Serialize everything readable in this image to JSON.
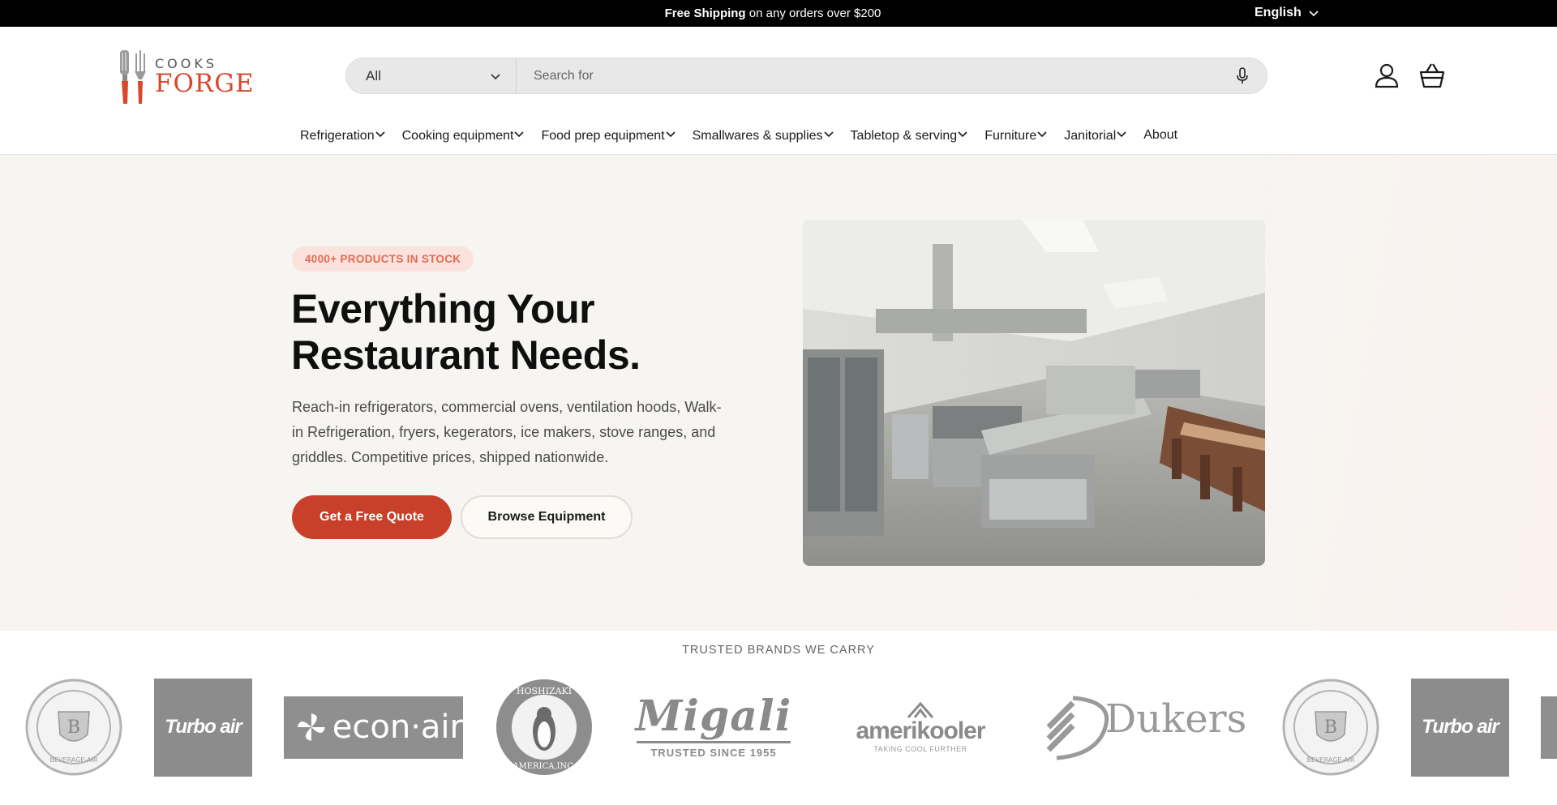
{
  "announcement": {
    "bold": "Free Shipping",
    "text": " on any orders over $200",
    "language": "English"
  },
  "logo": {
    "top": "COOKS",
    "bottom": "FORGE"
  },
  "search": {
    "category": "All",
    "placeholder": "Search for"
  },
  "nav": {
    "items": [
      {
        "label": "Refrigeration",
        "has_menu": true
      },
      {
        "label": "Cooking equipment",
        "has_menu": true
      },
      {
        "label": "Food prep equipment",
        "has_menu": true
      },
      {
        "label": "Smallwares & supplies",
        "has_menu": true
      },
      {
        "label": "Tabletop & serving",
        "has_menu": true
      },
      {
        "label": "Furniture",
        "has_menu": true
      },
      {
        "label": "Janitorial",
        "has_menu": true
      },
      {
        "label": "About",
        "has_menu": false
      }
    ]
  },
  "hero": {
    "badge": "4000+ PRODUCTS IN STOCK",
    "title_line1": "Everything Your",
    "title_line2": "Restaurant Needs.",
    "description": "Reach-in refrigerators, commercial ovens, ventilation hoods, Walk-in Refrigeration, fryers, kegerators, ice makers, stove ranges, and griddles. Competitive prices, shipped nationwide.",
    "primary_cta": "Get a Free Quote",
    "secondary_cta": "Browse Equipment"
  },
  "brands": {
    "title": "TRUSTED BRANDS WE CARRY",
    "turbo": "Turbo air",
    "econ": "econ·air",
    "hoshizaki_top": "HOSHIZAKI",
    "hoshizaki_bottom": "AMERICA,INC.",
    "migali": "Migali",
    "migali_sub": "TRUSTED SINCE 1955",
    "amerikooler": "amerikooler",
    "amerikooler_sub": "TAKING COOL FURTHER",
    "dukers": "Dukers",
    "beverage_air": "BEVERAGE-AIR"
  },
  "colors": {
    "accent": "#c9402a",
    "badge_bg": "#fbe2dc",
    "badge_text": "#e26a52",
    "hero_bg": "#f6f5f2"
  }
}
